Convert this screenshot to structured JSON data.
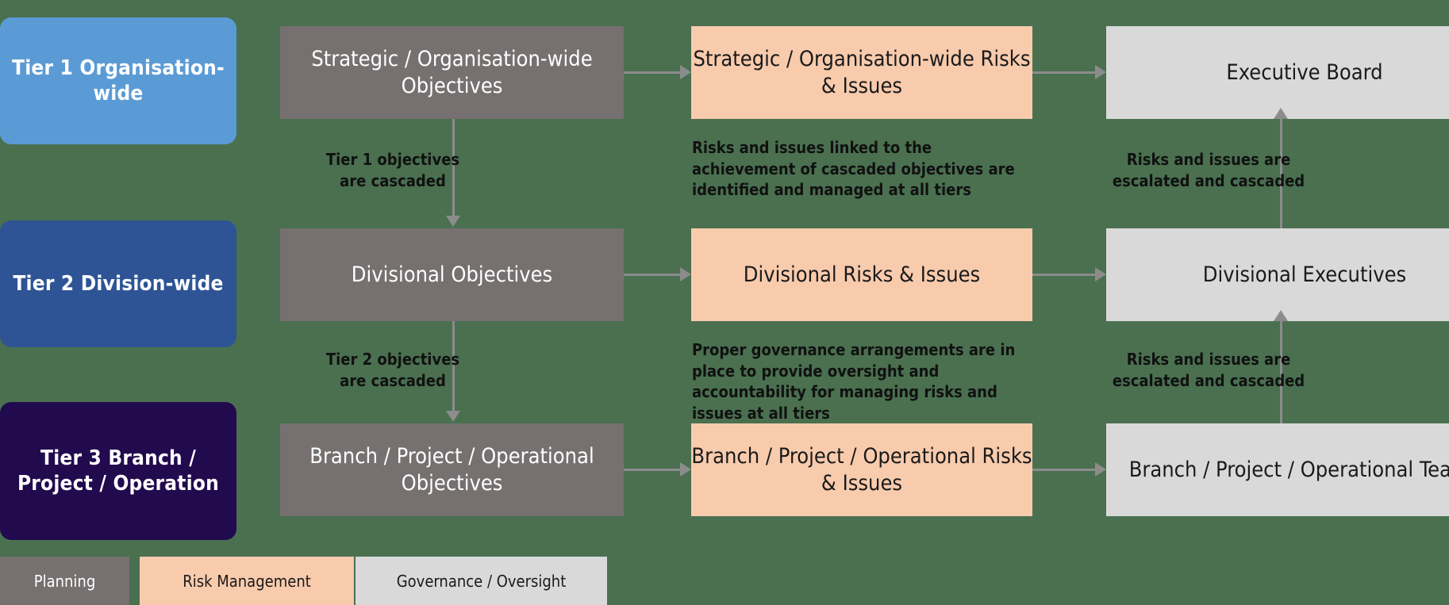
{
  "colors": {
    "background": "#4a7050",
    "tier1": "#5b9bd5",
    "tier2": "#2e5496",
    "tier3": "#220a4e",
    "planning": "#767070",
    "risk": "#f8cbad",
    "governance": "#d9d9d9",
    "connector": "#8c8c8c"
  },
  "tiers": [
    {
      "label": "Tier 1\nOrganisation-wide"
    },
    {
      "label": "Tier 2\nDivision-wide"
    },
    {
      "label": "Tier 3\nBranch / Project /\nOperation"
    }
  ],
  "objectives": [
    {
      "label": "Strategic / Organisation-wide Objectives"
    },
    {
      "label": "Divisional Objectives"
    },
    {
      "label": "Branch / Project / Operational Objectives"
    }
  ],
  "risks": [
    {
      "label": "Strategic / Organisation-wide Risks & Issues"
    },
    {
      "label": "Divisional Risks & Issues"
    },
    {
      "label": "Branch / Project / Operational Risks & Issues"
    }
  ],
  "governance": [
    {
      "label": "Executive Board"
    },
    {
      "label": "Divisional Executives"
    },
    {
      "label": "Branch / Project / Operational Teams"
    }
  ],
  "captions": {
    "cascade_tier1": "Tier 1 objectives\nare cascaded",
    "cascade_tier2": "Tier 2 objectives\nare cascaded",
    "risks_linked": "Risks and issues linked to the achievement of cascaded objectives are identified and managed at all tiers",
    "governance_arrangements": "Proper governance arrangements are in place to provide oversight and accountability for managing risks and issues at all tiers",
    "escalated_1": "Risks and issues are\nescalated and cascaded",
    "escalated_2": "Risks and issues are\nescalated and cascaded"
  },
  "legend": [
    {
      "label": "Planning"
    },
    {
      "label": "Risk Management"
    },
    {
      "label": "Governance / Oversight"
    }
  ]
}
